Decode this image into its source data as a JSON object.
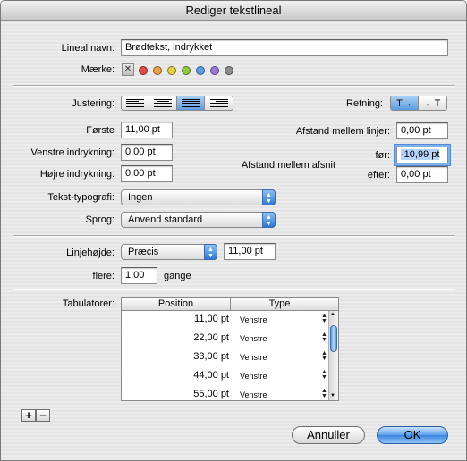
{
  "window": {
    "title": "Rediger tekstlineal"
  },
  "lineal_navn": {
    "label": "Lineal navn:",
    "value": "Brødtekst, indrykket"
  },
  "maerke": {
    "label": "Mærke:",
    "clear_symbol": "✕",
    "colors": [
      "#e04a4a",
      "#f0a040",
      "#e8d23a",
      "#8fcc3a",
      "#5aa0e8",
      "#9a78d8",
      "#8c8c8c"
    ]
  },
  "justering": {
    "label": "Justering:",
    "options": [
      "left",
      "center",
      "justify",
      "right"
    ],
    "selected": "justify"
  },
  "retning": {
    "label": "Retning:",
    "ltr_symbol": "T→",
    "rtl_symbol": "←T",
    "selected": "ltr"
  },
  "indent": {
    "forste": {
      "label": "Første",
      "value": "11,00 pt"
    },
    "venstre": {
      "label": "Venstre indrykning:",
      "value": "0,00 pt"
    },
    "hojre": {
      "label": "Højre indrykning:",
      "value": "0,00 pt"
    }
  },
  "spacing": {
    "linjer_label": "Afstand mellem linjer:",
    "linjer_value": "0,00 pt",
    "afsnit_label": "Afstand mellem afsnit",
    "for_label": "før:",
    "for_value": "-10,99 pt",
    "efter_label": "efter:",
    "efter_value": "0,00 pt"
  },
  "typografi": {
    "label": "Tekst-typografi:",
    "value": "Ingen"
  },
  "sprog": {
    "label": "Sprog:",
    "value": "Anvend standard"
  },
  "linjehojde": {
    "label": "Linjehøjde:",
    "mode": "Præcis",
    "value": "11,00 pt",
    "flere_label": "flere:",
    "flere_value": "1,00",
    "gange_label": "gange"
  },
  "tabulatorer": {
    "label": "Tabulatorer:",
    "col_position": "Position",
    "col_type": "Type",
    "rows": [
      {
        "position": "11,00 pt",
        "type": "Venstre"
      },
      {
        "position": "22,00 pt",
        "type": "Venstre"
      },
      {
        "position": "33,00 pt",
        "type": "Venstre"
      },
      {
        "position": "44,00 pt",
        "type": "Venstre"
      },
      {
        "position": "55,00 pt",
        "type": "Venstre"
      }
    ]
  },
  "buttons": {
    "add": "+",
    "remove": "−",
    "cancel": "Annuller",
    "ok": "OK"
  }
}
